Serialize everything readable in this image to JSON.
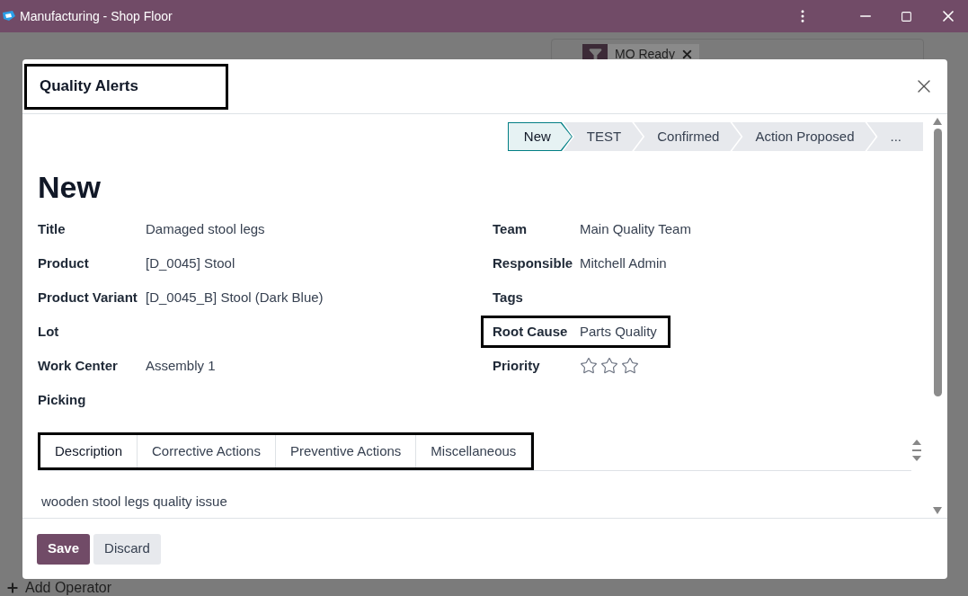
{
  "window": {
    "title": "Manufacturing - Shop Floor"
  },
  "background": {
    "filter_chip": "MO Ready",
    "add_operator": "Add Operator"
  },
  "dialog": {
    "title": "Quality Alerts",
    "title_highlighted": true,
    "stages": [
      {
        "label": "New",
        "selected": true
      },
      {
        "label": "TEST",
        "selected": false
      },
      {
        "label": "Confirmed",
        "selected": false
      },
      {
        "label": "Action Proposed",
        "selected": false
      },
      {
        "label": "...",
        "selected": false
      }
    ],
    "record_name": "New",
    "left_fields": [
      {
        "label": "Title",
        "value": "Damaged stool legs"
      },
      {
        "label": "Product",
        "value": "[D_0045] Stool"
      },
      {
        "label": "Product Variant",
        "value": "[D_0045_B] Stool (Dark Blue)"
      },
      {
        "label": "Lot"
      },
      {
        "label": "Work Center",
        "value": "Assembly 1"
      },
      {
        "label": "Picking"
      }
    ],
    "right_fields": [
      {
        "kind": "text",
        "label": "Team",
        "value": "Main Quality Team",
        "highlighted": false
      },
      {
        "kind": "text",
        "label": "Responsible",
        "value": "Mitchell Admin",
        "highlighted": false
      },
      {
        "kind": "text",
        "label": "Tags",
        "highlighted": false
      },
      {
        "kind": "text",
        "label": "Root Cause",
        "value": "Parts Quality",
        "highlighted": true
      },
      {
        "kind": "stars",
        "label": "Priority",
        "stars": 0,
        "highlighted": false
      }
    ],
    "tabs_highlighted": true,
    "tabs": [
      {
        "label": "Description",
        "selected": true
      },
      {
        "label": "Corrective Actions",
        "selected": false
      },
      {
        "label": "Preventive Actions",
        "selected": false
      },
      {
        "label": "Miscellaneous",
        "selected": false
      }
    ],
    "description": "wooden stool legs quality issue",
    "buttons": [
      {
        "label": "Save",
        "kind": "primary"
      },
      {
        "label": "Discard",
        "kind": "secondary"
      }
    ]
  }
}
